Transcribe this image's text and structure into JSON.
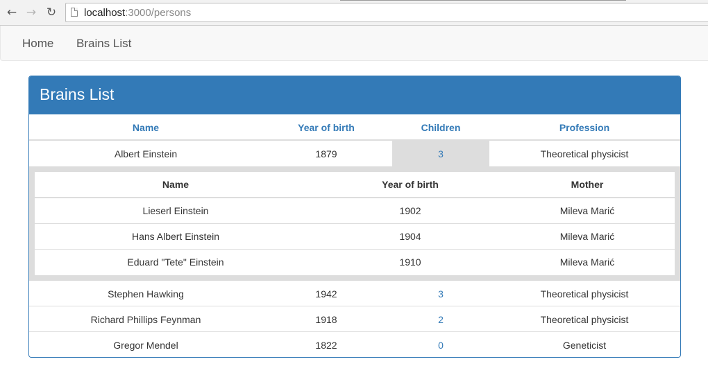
{
  "browser": {
    "url_host": "localhost",
    "url_rest": ":3000/persons",
    "back_glyph": "arrow-left-icon",
    "forward_glyph": "arrow-right-icon",
    "reload_glyph": "reload-icon"
  },
  "navbar": {
    "items": [
      {
        "label": "Home"
      },
      {
        "label": "Brains List"
      }
    ]
  },
  "panel": {
    "title": "Brains List",
    "columns": [
      "Name",
      "Year of birth",
      "Children",
      "Profession"
    ],
    "rows": [
      {
        "name": "Albert Einstein",
        "year": "1879",
        "children": "3",
        "profession": "Theoretical physicist",
        "expanded": true
      },
      {
        "name": "Stephen Hawking",
        "year": "1942",
        "children": "3",
        "profession": "Theoretical physicist"
      },
      {
        "name": "Richard Phillips Feynman",
        "year": "1918",
        "children": "2",
        "profession": "Theoretical physicist"
      },
      {
        "name": "Gregor Mendel",
        "year": "1822",
        "children": "0",
        "profession": "Geneticist"
      }
    ],
    "children_table": {
      "columns": [
        "Name",
        "Year of birth",
        "Mother"
      ],
      "rows": [
        {
          "name": "Lieserl Einstein",
          "year": "1902",
          "mother": "Mileva Marić"
        },
        {
          "name": "Hans Albert Einstein",
          "year": "1904",
          "mother": "Mileva Marić"
        },
        {
          "name": "Eduard \"Tete\" Einstein",
          "year": "1910",
          "mother": "Mileva Marić"
        }
      ]
    }
  },
  "colors": {
    "primary": "#337ab7",
    "expanded_bg": "#dddddd"
  }
}
